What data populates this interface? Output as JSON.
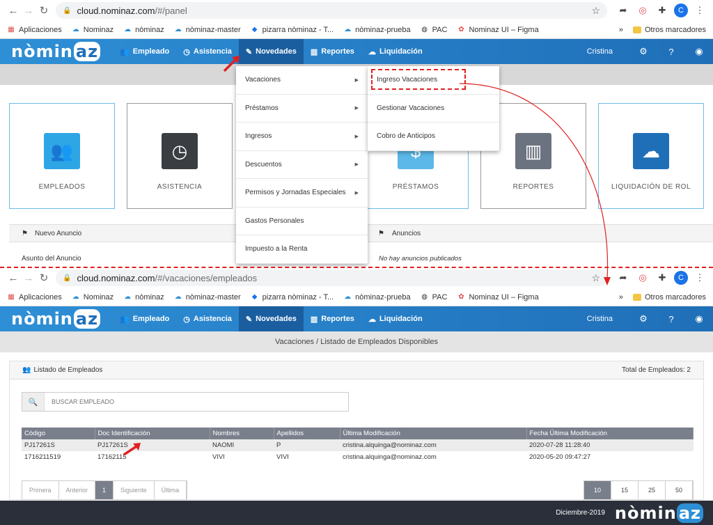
{
  "browser_top": {
    "url_host": "cloud.nominaz.com",
    "url_path": "/#/panel",
    "avatar_letter": "C"
  },
  "browser_bottom": {
    "url_host": "cloud.nominaz.com",
    "url_path": "/#/vacaciones/empleados",
    "avatar_letter": "C"
  },
  "bookmarks": {
    "items": [
      "Aplicaciones",
      "Nominaz",
      "nòminaz",
      "nòminaz-master",
      "pizarra nòminaz - T...",
      "nòminaz-prueba",
      "PAC",
      "Nominaz UI – Figma"
    ],
    "more": "»",
    "folder": "Otros marcadores"
  },
  "app": {
    "logo": "nòmin",
    "logo_az": "az",
    "menu": [
      "Empleado",
      "Asistencia",
      "Novedades",
      "Reportes",
      "Liquidación"
    ],
    "user": "Cristina"
  },
  "panel": {
    "cards": [
      "EMPLEADOS",
      "ASISTENCIA",
      "PRÉSTAMOS",
      "REPORTES",
      "LIQUIDACIÓN DE ROL"
    ],
    "new_announcement": "Nuevo Anuncio",
    "announcements": "Anuncios",
    "subject_label": "Asunto del Anuncio",
    "no_announcements": "No hay anuncios publicados"
  },
  "dropdown": {
    "items": [
      "Vacaciones",
      "Préstamos",
      "Ingresos",
      "Descuentos",
      "Permisos y Jornadas Especiales",
      "Gastos Personales",
      "Impuesto a la Renta"
    ],
    "submenu": [
      "Ingreso Vacaciones",
      "Gestionar Vacaciones",
      "Cobro de Anticipos"
    ]
  },
  "employees": {
    "breadcrumb": "Vacaciones / Listado de Empleados Disponibles",
    "title": "Listado de Empleados",
    "total": "Total de Empleados: 2",
    "search_placeholder": "BUSCAR EMPLEADO",
    "columns": [
      "Código",
      "Doc Identificación",
      "Nombres",
      "Apellidos",
      "Última Modificación",
      "Fecha Última Modificación"
    ],
    "rows": [
      [
        "PJ17261S",
        "PJ17261S",
        "NAOMI",
        "P",
        "cristina.alquinga@nominaz.com",
        "2020-07-28 11:28:40"
      ],
      [
        "1716211519",
        "17162115",
        "VIVI",
        "VIVI",
        "cristina.alquinga@nominaz.com",
        "2020-05-20 09:47:27"
      ]
    ],
    "pager": [
      "Primera",
      "Anterior",
      "1",
      "Siguiente",
      "Última"
    ],
    "page_sizes": [
      "10",
      "15",
      "25",
      "50"
    ]
  },
  "footer": {
    "date": "Diciembre-2019",
    "logo": "nòmin",
    "logo_az": "az"
  },
  "colors": {
    "nav_blue": "#2e8fd6",
    "nav_active": "#1a5ea0",
    "annotation_red": "#e02020",
    "table_header": "#7a7f8c",
    "footer": "#2a2f3a"
  }
}
